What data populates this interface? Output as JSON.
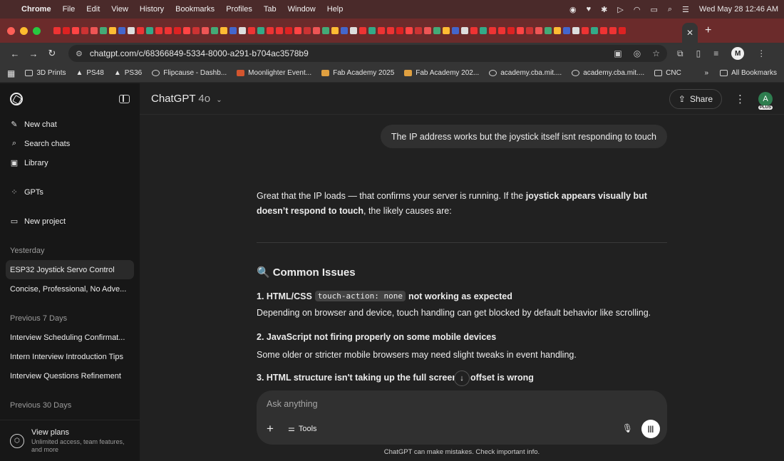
{
  "menubar": {
    "app": "Chrome",
    "items": [
      "File",
      "Edit",
      "View",
      "History",
      "Bookmarks",
      "Profiles",
      "Tab",
      "Window",
      "Help"
    ],
    "datetime": "Wed May 28  12:46 AM"
  },
  "browser": {
    "url": "chatgpt.com/c/68366849-5334-8000-a291-b704ac3578b9",
    "profile_initial": "M",
    "bookmarks": [
      "3D Prints",
      "PS48",
      "PS36",
      "Flipcause - Dashb...",
      "Moonlighter Event...",
      "Fab Academy 2025",
      "Fab Academy 202...",
      "academy.cba.mit....",
      "academy.cba.mit....",
      "CNC"
    ],
    "all_bookmarks": "All Bookmarks"
  },
  "sidebar": {
    "new_chat": "New chat",
    "search_chats": "Search chats",
    "library": "Library",
    "gpts": "GPTs",
    "new_project": "New project",
    "sections": [
      {
        "title": "Yesterday",
        "chats": [
          "ESP32 Joystick Servo Control",
          "Concise, Professional, No Adve..."
        ]
      },
      {
        "title": "Previous 7 Days",
        "chats": [
          "Interview Scheduling Confirmat...",
          "Intern Interview Introduction Tips",
          "Interview Questions Refinement"
        ]
      },
      {
        "title": "Previous 30 Days",
        "chats": []
      }
    ],
    "plans": {
      "title": "View plans",
      "subtitle_1": "Unlimited access, team features,",
      "subtitle_2": "and more"
    }
  },
  "header": {
    "model": "ChatGPT",
    "version": "4o",
    "share": "Share",
    "avatar_initial": "A",
    "plan_badge": "PLUS"
  },
  "conversation": {
    "user_message": "The IP address works but the joystick itself isnt responding to touch",
    "answer_p1_a": "Great that the IP loads — that confirms your server is running. If the ",
    "answer_p1_b": "joystick appears visually but doesn’t respond to touch",
    "answer_p1_c": ", the likely causes are:",
    "issues_heading": "Common Issues",
    "issues": [
      {
        "title_a": "1. HTML/CSS ",
        "code": "touch-action: none",
        "title_b": " not working as expected",
        "body": "Depending on browser and device, touch handling can get blocked by default behavior like scrolling."
      },
      {
        "title_a": "2. JavaScript not firing properly on some mobile devices",
        "body": "Some older or stricter mobile browsers may need slight tweaks in event handling."
      },
      {
        "title_a": "3. HTML structure isn't taking up the full screen ",
        "title_b": "offset is wrong"
      }
    ]
  },
  "composer": {
    "placeholder": "Ask anything",
    "tools": "Tools",
    "disclaimer": "ChatGPT can make mistakes. Check important info."
  },
  "colors": {
    "page_bg": "#212121",
    "sidebar_bg": "#171717",
    "menubar_bg": "#4a2a2a",
    "tabstrip_bg": "#6b2b2b",
    "bubble_bg": "#303030"
  }
}
